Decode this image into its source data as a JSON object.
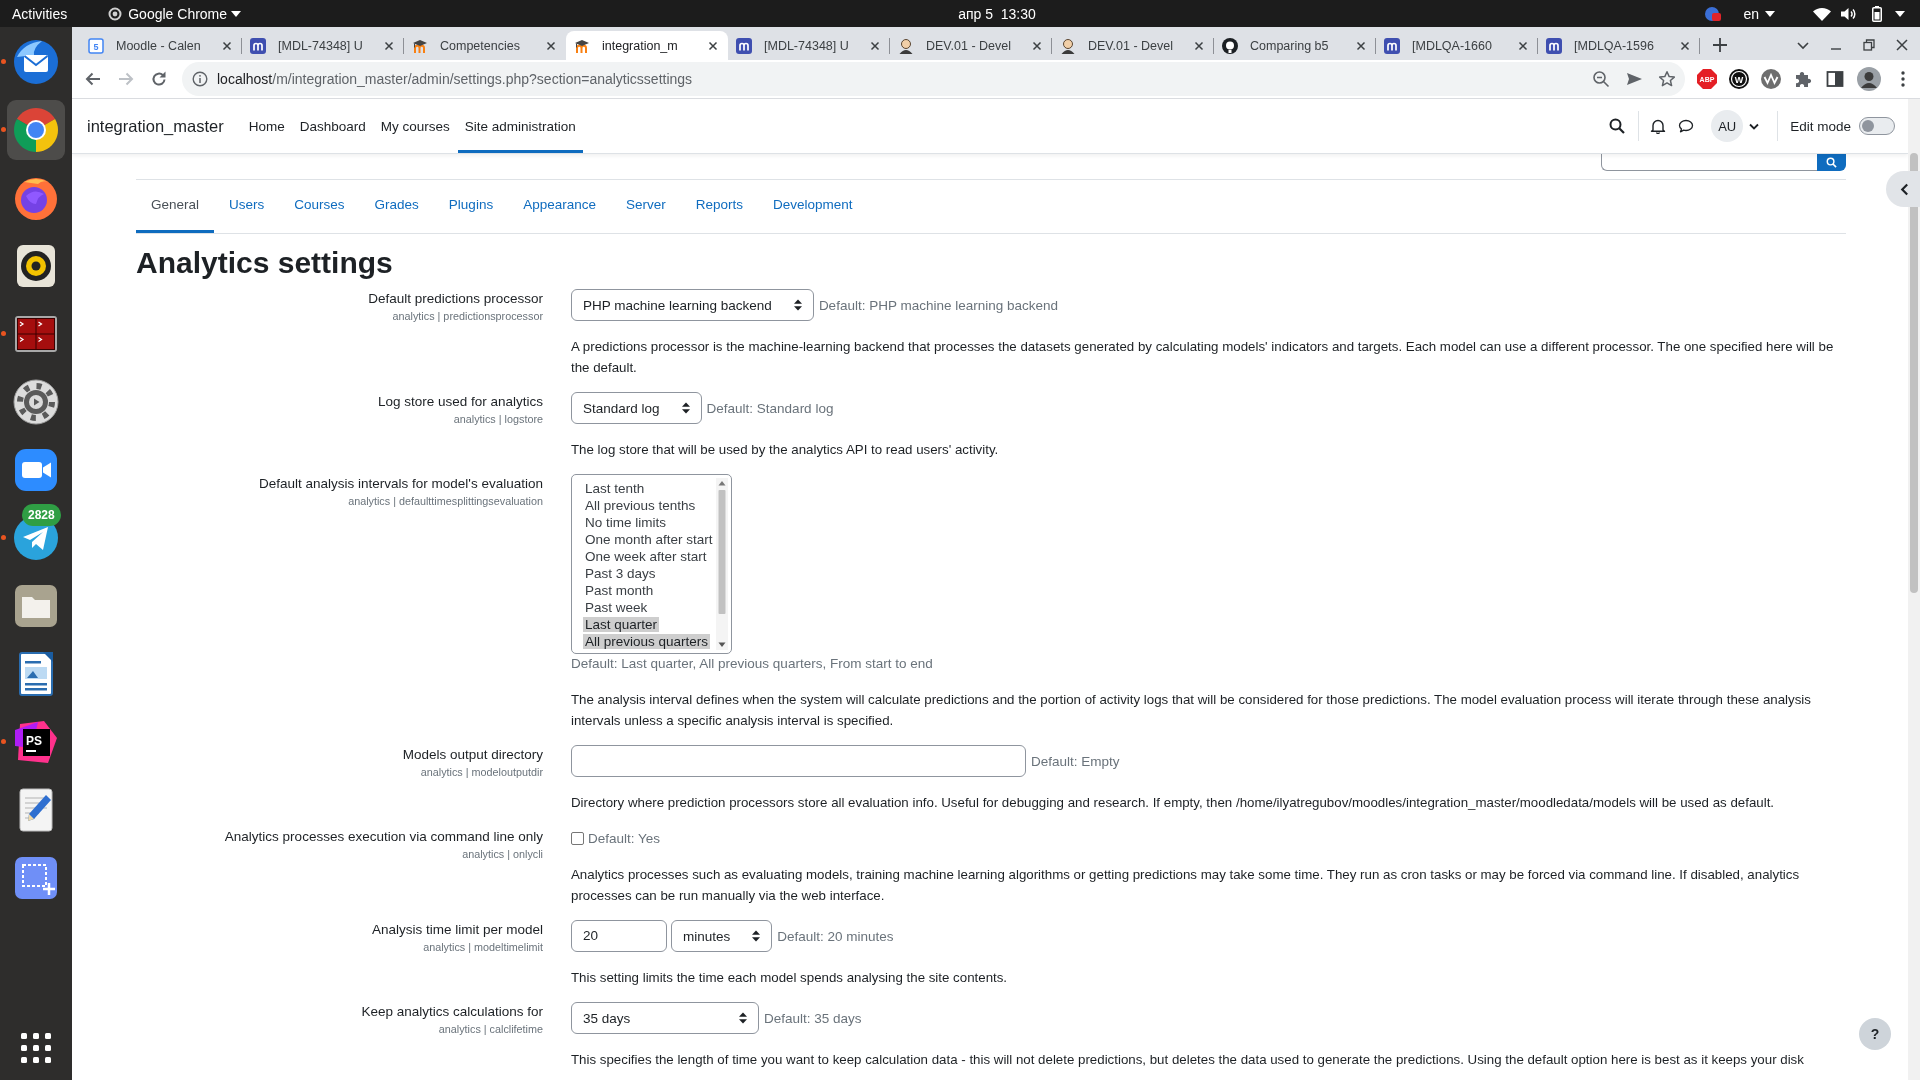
{
  "topbar": {
    "activities": "Activities",
    "app_menu": "Google Chrome",
    "clock": "апр 5  13:30",
    "language": "en"
  },
  "dock": {
    "items": [
      {
        "kind": "mail",
        "running": true,
        "selected": false
      },
      {
        "kind": "browser",
        "running": true,
        "selected": true
      },
      {
        "kind": "firefox",
        "running": false,
        "selected": false
      },
      {
        "kind": "music",
        "running": false,
        "selected": false
      },
      {
        "kind": "terminal",
        "running": true,
        "selected": false
      },
      {
        "kind": "settings",
        "running": false,
        "selected": false
      },
      {
        "kind": "video",
        "running": false,
        "selected": false
      },
      {
        "kind": "messenger",
        "running": true,
        "selected": false,
        "badge": "2828"
      },
      {
        "kind": "files",
        "running": false,
        "selected": false
      },
      {
        "kind": "writer",
        "running": false,
        "selected": false
      },
      {
        "kind": "ide",
        "running": true,
        "selected": false,
        "text": "PS"
      },
      {
        "kind": "editor",
        "running": false,
        "selected": false
      },
      {
        "kind": "screenshot",
        "running": false,
        "selected": false
      }
    ]
  },
  "browser": {
    "tabs": [
      {
        "kind": "calendar",
        "icon_text": "5",
        "title": "Moodle - Calen",
        "selected": false
      },
      {
        "kind": "tracker",
        "title": "[MDL-74348] U",
        "selected": false
      },
      {
        "kind": "moodle",
        "title": "Competencies",
        "selected": false
      },
      {
        "kind": "moodle",
        "title": "integration_m",
        "selected": true
      },
      {
        "kind": "tracker",
        "title": "[MDL-74348] U",
        "selected": false
      },
      {
        "kind": "person",
        "title": "DEV.01 - Devel",
        "selected": false
      },
      {
        "kind": "person",
        "title": "DEV.01 - Devel",
        "selected": false
      },
      {
        "kind": "github",
        "title": "Comparing b5",
        "selected": false
      },
      {
        "kind": "tracker",
        "title": "[MDLQA-1660",
        "selected": false
      },
      {
        "kind": "tracker",
        "title": "[MDLQA-1596",
        "selected": false
      }
    ],
    "nav_buttons": [
      {
        "kind": "back",
        "disabled": false
      },
      {
        "kind": "forward",
        "disabled": true
      },
      {
        "kind": "reload",
        "disabled": false
      }
    ],
    "url": {
      "host": "localhost",
      "path": "/m/integration_master/admin/settings.php?section=analyticssettings"
    },
    "extensions": [
      {
        "kind": "stop-sign",
        "text": "ABP"
      },
      {
        "kind": "circle-letter",
        "text": "W"
      },
      {
        "kind": "wave"
      },
      {
        "kind": "puzzle"
      },
      {
        "kind": "sidebar"
      },
      {
        "kind": "avatar"
      }
    ]
  },
  "navbar": {
    "brand": "integration_master",
    "items": [
      {
        "label": "Home",
        "selected": false
      },
      {
        "label": "Dashboard",
        "selected": false
      },
      {
        "label": "My courses",
        "selected": false
      },
      {
        "label": "Site administration",
        "selected": true
      }
    ],
    "user_initials": "AU",
    "edit_mode": {
      "label": "Edit mode",
      "on": false
    }
  },
  "page": {
    "tabs": [
      {
        "label": "General",
        "selected": true
      },
      {
        "label": "Users",
        "selected": false
      },
      {
        "label": "Courses",
        "selected": false
      },
      {
        "label": "Grades",
        "selected": false
      },
      {
        "label": "Plugins",
        "selected": false
      },
      {
        "label": "Appearance",
        "selected": false
      },
      {
        "label": "Server",
        "selected": false
      },
      {
        "label": "Reports",
        "selected": false
      },
      {
        "label": "Development",
        "selected": false
      }
    ],
    "heading": "Analytics settings",
    "settings": [
      {
        "kind": "select",
        "label": "Default predictions processor",
        "name": "analytics | predictionsprocessor",
        "value": "PHP machine learning backend",
        "default": "Default: PHP machine learning backend",
        "description": "A predictions processor is the machine-learning backend that processes the datasets generated by calculating models' indicators and targets. Each model can use a different processor. The one specified here will be the default."
      },
      {
        "kind": "select",
        "label": "Log store used for analytics",
        "name": "analytics | logstore",
        "value": "Standard log",
        "default": "Default: Standard log",
        "description": "The log store that will be used by the analytics API to read users' activity."
      },
      {
        "kind": "listbox",
        "label": "Default analysis intervals for model's evaluation",
        "name": "analytics | defaulttimesplittingsevaluation",
        "options": [
          {
            "label": "Last tenth",
            "selected": false
          },
          {
            "label": "All previous tenths",
            "selected": false
          },
          {
            "label": "No time limits",
            "selected": false
          },
          {
            "label": "One month after start",
            "selected": false
          },
          {
            "label": "One week after start",
            "selected": false
          },
          {
            "label": "Past 3 days",
            "selected": false
          },
          {
            "label": "Past month",
            "selected": false
          },
          {
            "label": "Past week",
            "selected": false
          },
          {
            "label": "Last quarter",
            "selected": true
          },
          {
            "label": "All previous quarters",
            "selected": true
          }
        ],
        "default": "Default: Last quarter, All previous quarters, From start to end",
        "description": "The analysis interval defines when the system will calculate predictions and the portion of activity logs that will be considered for those predictions. The model evaluation process will iterate through these analysis intervals unless a specific analysis interval is specified."
      },
      {
        "kind": "text",
        "label": "Models output directory",
        "name": "analytics | modeloutputdir",
        "default": "Default: Empty",
        "description": "Directory where prediction processors store all evaluation info. Useful for debugging and research. If empty, then /home/ilyatregubov/moodles/integration_master/moodledata/models will be used as default."
      },
      {
        "kind": "checkbox",
        "label": "Analytics processes execution via command line only",
        "name": "analytics | onlycli",
        "checked": false,
        "default": "Default: Yes",
        "description": "Analytics processes such as evaluating models, training machine learning algorithms or getting predictions may take some time. They run as cron tasks or may be forced via command line. If disabled, analytics processes can be run manually via the web interface."
      },
      {
        "kind": "duration",
        "label": "Analysis time limit per model",
        "name": "analytics | modeltimelimit",
        "value": "20",
        "unit": "minutes",
        "default": "Default: 20 minutes",
        "description": "This setting limits the time each model spends analysing the site contents."
      },
      {
        "kind": "select",
        "label": "Keep analytics calculations for",
        "name": "analytics | calclifetime",
        "value": "35 days",
        "default": "Default: 35 days",
        "description": "This specifies the length of time you want to keep calculation data - this will not delete predictions, but deletes the data used to generate the predictions. Using the default option here is best as it keeps your disk"
      }
    ],
    "help": "?"
  }
}
